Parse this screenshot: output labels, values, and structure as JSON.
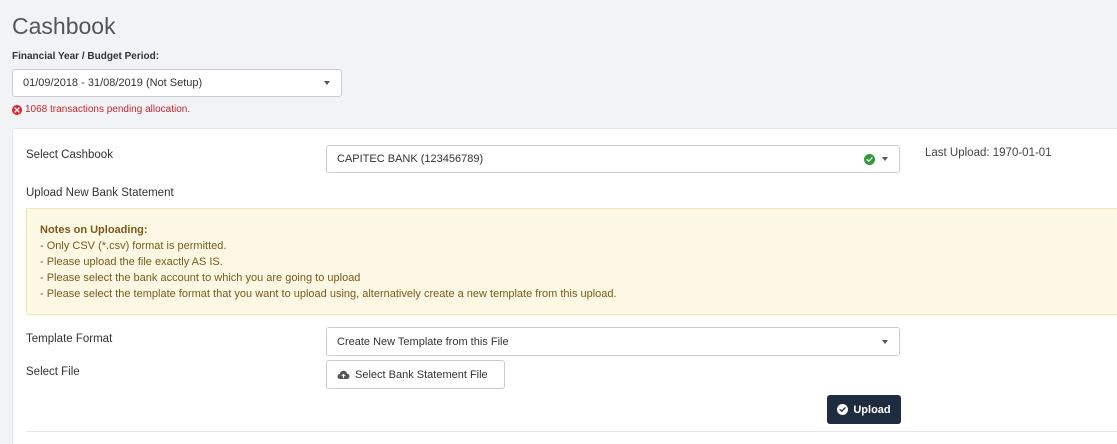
{
  "page": {
    "title": "Cashbook"
  },
  "financial_year": {
    "label": "Financial Year / Budget Period:",
    "selected": "01/09/2018 - 31/08/2019 (Not Setup)"
  },
  "status": {
    "pending_text": "1068 transactions pending allocation.",
    "icon": "error-circle-icon"
  },
  "form": {
    "select_cashbook_label": "Select Cashbook",
    "cashbook_selected": "CAPITEC BANK (123456789)",
    "last_upload": "Last Upload: 1970-01-01",
    "upload_new_label": "Upload New Bank Statement",
    "notes": {
      "title": "Notes on Uploading:",
      "lines": [
        "- Only CSV (*.csv) format is permitted.",
        "- Please upload the file exactly AS IS.",
        "- Please select the bank account to which you are going to upload",
        "- Please select the template format that you want to upload using, alternatively create a new template from this upload."
      ]
    },
    "template_format_label": "Template Format",
    "template_selected": "Create New Template from this File",
    "select_file_label": "Select File",
    "select_file_button": "Select Bank Statement File",
    "upload_button": "Upload"
  },
  "colors": {
    "error": "#d9252b",
    "success": "#2e9a36",
    "primary_button": "#1f2b3e",
    "notes_bg": "#fcf8e3",
    "notes_text": "#7a5a1c"
  }
}
